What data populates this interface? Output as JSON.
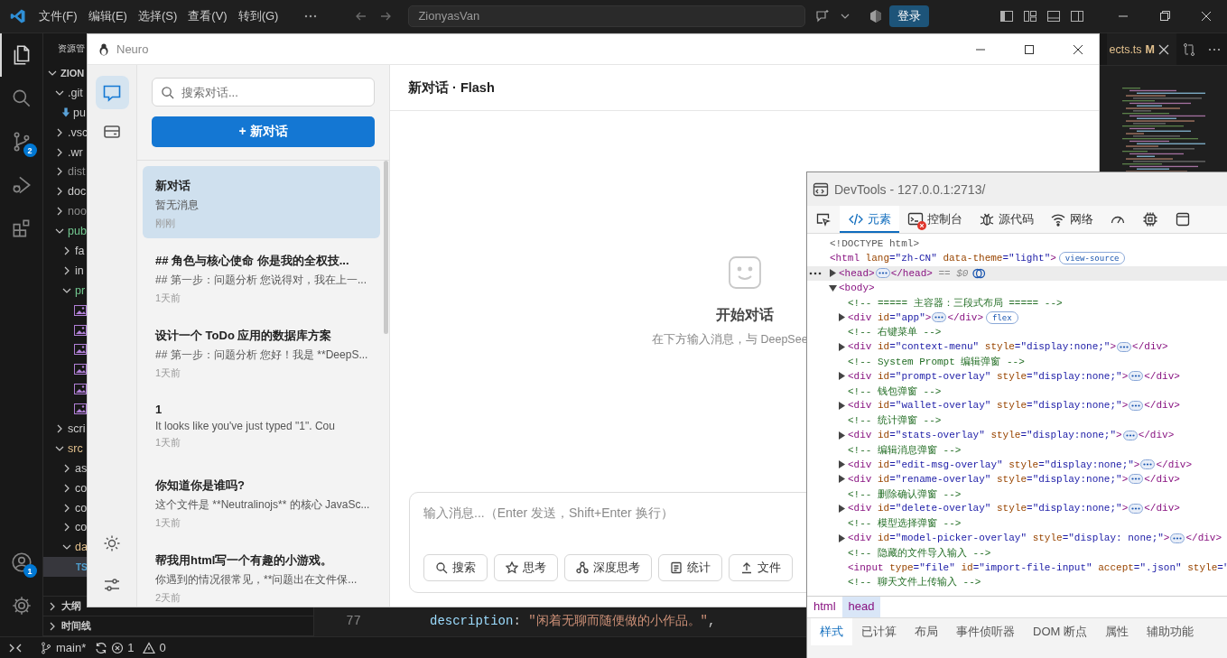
{
  "vscode": {
    "menus": [
      "文件(F)",
      "编辑(E)",
      "选择(S)",
      "查看(V)",
      "转到(G)"
    ],
    "search": {
      "value": "ZionyasVan"
    },
    "login_button": "登录",
    "activity": [
      {
        "kind": "files",
        "selected": true
      },
      {
        "kind": "search",
        "selected": false
      },
      {
        "kind": "git",
        "selected": false,
        "badge": "2"
      },
      {
        "kind": "debug",
        "selected": false
      },
      {
        "kind": "extensions",
        "selected": false
      }
    ],
    "activity_bottom": [
      {
        "kind": "account",
        "badge": "1"
      },
      {
        "kind": "settings"
      }
    ],
    "explorer": {
      "title": "资源管",
      "tree": [
        {
          "kind": "folder",
          "name": "ZION",
          "expanded": true,
          "selected": false,
          "children": [
            {
              "kind": "folder",
              "name": ".git",
              "expanded": true,
              "selected": false,
              "children": [
                {
                  "kind": "download",
                  "name": "pu",
                  "selected": false
                }
              ]
            },
            {
              "kind": "folder",
              "name": ".vsc",
              "expanded": false,
              "selected": false
            },
            {
              "kind": "folder",
              "name": ".wr",
              "expanded": false,
              "selected": false
            },
            {
              "kind": "folder",
              "name": "dist",
              "expanded": false,
              "selected": false,
              "color": "#8c8c8c"
            },
            {
              "kind": "folder",
              "name": "doc",
              "expanded": false,
              "selected": false
            },
            {
              "kind": "folder",
              "name": "noo",
              "expanded": false,
              "selected": false,
              "color": "#8c8c8c"
            },
            {
              "kind": "folder",
              "name": "pub",
              "expanded": true,
              "selected": false,
              "color": "#73c991",
              "children": [
                {
                  "kind": "folder",
                  "name": "fa",
                  "expanded": false,
                  "selected": false
                },
                {
                  "kind": "folder",
                  "name": "in",
                  "expanded": false,
                  "selected": false
                },
                {
                  "kind": "folder",
                  "name": "pr",
                  "expanded": true,
                  "selected": false,
                  "color": "#73c991",
                  "children": [
                    {
                      "kind": "image",
                      "selected": false
                    },
                    {
                      "kind": "image",
                      "selected": false
                    },
                    {
                      "kind": "image",
                      "selected": false
                    },
                    {
                      "kind": "image",
                      "selected": false
                    },
                    {
                      "kind": "image",
                      "selected": false
                    },
                    {
                      "kind": "image",
                      "selected": false
                    }
                  ]
                }
              ]
            },
            {
              "kind": "folder",
              "name": "scri",
              "expanded": false,
              "selected": false
            },
            {
              "kind": "folder",
              "name": "src",
              "expanded": true,
              "selected": false,
              "color": "#e2c08d",
              "children": [
                {
                  "kind": "folder",
                  "name": "as",
                  "expanded": false,
                  "selected": false
                },
                {
                  "kind": "folder",
                  "name": "co",
                  "expanded": false,
                  "selected": false
                },
                {
                  "kind": "folder",
                  "name": "co",
                  "expanded": false,
                  "selected": false
                },
                {
                  "kind": "folder",
                  "name": "co",
                  "expanded": false,
                  "selected": false
                },
                {
                  "kind": "folder",
                  "name": "da",
                  "expanded": true,
                  "selected": false,
                  "color": "#e2c08d",
                  "children": [
                    {
                      "kind": "ts",
                      "icon_text": "TS",
                      "selected": true
                    }
                  ]
                }
              ]
            }
          ]
        }
      ]
    },
    "panels": [
      "大纲",
      "时间线"
    ],
    "editor": {
      "tab": {
        "label": "ects.ts",
        "status": "M"
      },
      "lines": [
        {
          "number": "77",
          "tokens": [
            {
              "kind": "key",
              "text": "description"
            },
            {
              "kind": "punct",
              "text": ":"
            },
            {
              "kind": "string",
              "text": "\"闲着无聊而随便做的小作品。\""
            },
            {
              "kind": "punct",
              "text": ","
            }
          ]
        }
      ]
    },
    "status_bar": {
      "branch": "main*",
      "errors": "1",
      "warnings": "0"
    }
  },
  "neuro": {
    "title": "Neuro",
    "rail": [
      {
        "kind": "chat",
        "selected": true
      },
      {
        "kind": "wallet",
        "selected": false
      }
    ],
    "rail_bottom": [
      {
        "kind": "theme"
      },
      {
        "kind": "settings"
      }
    ],
    "search": {
      "placeholder": "搜索对话..."
    },
    "new_button": "+ 新对话",
    "conversations": [
      {
        "title": "新对话",
        "preview": "暂无消息",
        "time": "刚刚",
        "selected": true
      },
      {
        "title": "## 角色与核心使命 你是我的全权技...",
        "preview": "## 第一步：问题分析 您说得对，我在上一...",
        "time": "1天前",
        "selected": false
      },
      {
        "title": "设计一个 ToDo 应用的数据库方案",
        "preview": "## 第一步：问题分析 您好！我是 **DeepS...",
        "time": "1天前",
        "selected": false
      },
      {
        "title": "1",
        "preview": "It looks like you've just typed \"1\". Cou",
        "time": "1天前",
        "selected": false
      },
      {
        "title": "你知道你是谁吗?",
        "preview": "这个文件是 **Neutralinojs** 的核心 JavaSc...",
        "time": "1天前",
        "selected": false
      },
      {
        "title": "帮我用html写一个有趣的小游戏。",
        "preview": "你遇到的情况很常见，**问题出在文件保...",
        "time": "2天前",
        "selected": false
      }
    ],
    "header": "新对话 · Flash",
    "empty": {
      "title": "开始对话",
      "hint": "在下方输入消息，与 DeepSee"
    },
    "composer": {
      "placeholder": "输入消息...（Enter 发送，Shift+Enter 换行）",
      "tools": [
        {
          "kind": "search",
          "label": "搜索"
        },
        {
          "kind": "think",
          "label": "思考"
        },
        {
          "kind": "deep",
          "label": "深度思考"
        },
        {
          "kind": "stats",
          "label": "统计"
        },
        {
          "kind": "file",
          "label": "文件"
        }
      ]
    }
  },
  "devtools": {
    "title": "DevTools - 127.0.0.1:2713/",
    "tabs": [
      {
        "kind": "inspect",
        "selected": false
      },
      {
        "kind": "elements",
        "label": "元素",
        "selected": true
      },
      {
        "kind": "console",
        "label": "控制台",
        "selected": false,
        "error": true
      },
      {
        "kind": "sources",
        "label": "源代码",
        "selected": false
      },
      {
        "kind": "network",
        "label": "网络",
        "selected": false
      },
      {
        "kind": "performance",
        "selected": false
      },
      {
        "kind": "memory",
        "selected": false
      },
      {
        "kind": "application",
        "selected": false
      }
    ],
    "dom": [
      {
        "kind": "doctype",
        "text": "<!DOCTYPE html>",
        "selected": false
      },
      {
        "kind": "element",
        "open": "<html",
        "attrs": [
          {
            "name": "lang",
            "value": "=\"zh-CN\""
          },
          {
            "name": "data-theme",
            "value": "=\"light\""
          }
        ],
        "close": ">",
        "badge": "view-source",
        "selected": false,
        "children": [
          {
            "kind": "element",
            "open": "<head",
            "close": ">",
            "expanded": false,
            "end": "</head>",
            "note": "== $0",
            "selected": true
          },
          {
            "kind": "element",
            "open": "<body",
            "close": ">",
            "expanded": true,
            "selected": false,
            "children": [
              {
                "kind": "comment",
                "text": "<!-- ===== 主容器：三段式布局 ===== -->",
                "selected": false
              },
              {
                "kind": "element",
                "open": "<div",
                "attrs": [
                  {
                    "name": "id",
                    "value": "=\"app\""
                  }
                ],
                "close": ">",
                "expanded": false,
                "end": "</div>",
                "badge": "flex",
                "selected": false
              },
              {
                "kind": "comment",
                "text": "<!-- 右键菜单 -->",
                "selected": false
              },
              {
                "kind": "element",
                "open": "<div",
                "attrs": [
                  {
                    "name": "id",
                    "value": "=\"context-menu\""
                  },
                  {
                    "name": "style",
                    "value": "=\"display:none;\""
                  }
                ],
                "close": ">",
                "expanded": false,
                "end": "</div>",
                "selected": false
              },
              {
                "kind": "comment",
                "text": "<!-- System Prompt 编辑弹窗 -->",
                "selected": false
              },
              {
                "kind": "element",
                "open": "<div",
                "attrs": [
                  {
                    "name": "id",
                    "value": "=\"prompt-overlay\""
                  },
                  {
                    "name": "style",
                    "value": "=\"display:none;\""
                  }
                ],
                "close": ">",
                "expanded": false,
                "end": "</div>",
                "selected": false
              },
              {
                "kind": "comment",
                "text": "<!-- 钱包弹窗 -->",
                "selected": false
              },
              {
                "kind": "element",
                "open": "<div",
                "attrs": [
                  {
                    "name": "id",
                    "value": "=\"wallet-overlay\""
                  },
                  {
                    "name": "style",
                    "value": "=\"display:none;\""
                  }
                ],
                "close": ">",
                "expanded": false,
                "end": "</div>",
                "selected": false
              },
              {
                "kind": "comment",
                "text": "<!-- 统计弹窗 -->",
                "selected": false
              },
              {
                "kind": "element",
                "open": "<div",
                "attrs": [
                  {
                    "name": "id",
                    "value": "=\"stats-overlay\""
                  },
                  {
                    "name": "style",
                    "value": "=\"display:none;\""
                  }
                ],
                "close": ">",
                "expanded": false,
                "end": "</div>",
                "selected": false
              },
              {
                "kind": "comment",
                "text": "<!-- 编辑消息弹窗 -->",
                "selected": false
              },
              {
                "kind": "element",
                "open": "<div",
                "attrs": [
                  {
                    "name": "id",
                    "value": "=\"edit-msg-overlay\""
                  },
                  {
                    "name": "style",
                    "value": "=\"display:none;\""
                  }
                ],
                "close": ">",
                "expanded": false,
                "end": "</div>",
                "selected": false
              },
              {
                "kind": "element",
                "open": "<div",
                "attrs": [
                  {
                    "name": "id",
                    "value": "=\"rename-overlay\""
                  },
                  {
                    "name": "style",
                    "value": "=\"display:none;\""
                  }
                ],
                "close": ">",
                "expanded": false,
                "end": "</div>",
                "selected": false
              },
              {
                "kind": "comment",
                "text": "<!-- 删除确认弹窗 -->",
                "selected": false
              },
              {
                "kind": "element",
                "open": "<div",
                "attrs": [
                  {
                    "name": "id",
                    "value": "=\"delete-overlay\""
                  },
                  {
                    "name": "style",
                    "value": "=\"display:none;\""
                  }
                ],
                "close": ">",
                "expanded": false,
                "end": "</div>",
                "selected": false
              },
              {
                "kind": "comment",
                "text": "<!-- 模型选择弹窗 -->",
                "selected": false
              },
              {
                "kind": "element",
                "open": "<div",
                "attrs": [
                  {
                    "name": "id",
                    "value": "=\"model-picker-overlay\""
                  },
                  {
                    "name": "style",
                    "value": "=\"display: none;\""
                  }
                ],
                "close": ">",
                "expanded": false,
                "end": "</div>",
                "selected": false
              },
              {
                "kind": "comment",
                "text": "<!-- 隐藏的文件导入输入 -->",
                "selected": false
              },
              {
                "kind": "element",
                "open": "<input",
                "attrs": [
                  {
                    "name": "type",
                    "value": "=\"file\""
                  },
                  {
                    "name": "id",
                    "value": "=\"import-file-input\""
                  },
                  {
                    "name": "accept",
                    "value": "=\".json\""
                  },
                  {
                    "name": "style",
                    "value": "=\""
                  }
                ],
                "selected": false
              },
              {
                "kind": "comment",
                "text": "<!-- 聊天文件上传输入 -->",
                "selected": false
              }
            ]
          }
        ]
      }
    ],
    "breadcrumbs": [
      {
        "label": "html",
        "selected": false
      },
      {
        "label": "head",
        "selected": true
      }
    ],
    "subtabs": [
      {
        "label": "样式",
        "selected": true
      },
      {
        "label": "已计算",
        "selected": false
      },
      {
        "label": "布局",
        "selected": false
      },
      {
        "label": "事件侦听器",
        "selected": false
      },
      {
        "label": "DOM 断点",
        "selected": false
      },
      {
        "label": "属性",
        "selected": false
      },
      {
        "label": "辅助功能",
        "selected": false
      }
    ]
  }
}
